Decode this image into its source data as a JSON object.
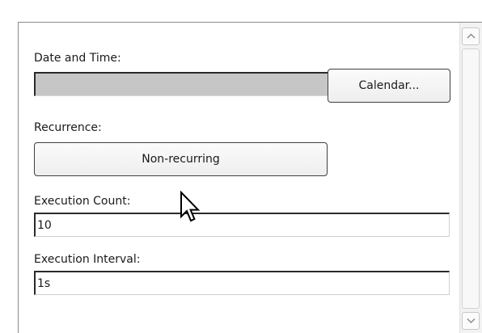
{
  "form": {
    "datetime_label": "Date and Time:",
    "datetime_value": "",
    "calendar_button": "Calendar...",
    "recurrence_label": "Recurrence:",
    "recurrence_button": "Non-recurring",
    "execution_count_label": "Execution Count:",
    "execution_count_value": "10",
    "execution_interval_label": "Execution Interval:",
    "execution_interval_value": "1s"
  },
  "icons": {
    "scroll_up": "chevron-up-icon",
    "scroll_down": "chevron-down-icon",
    "cursor": "mouse-pointer-icon"
  },
  "colors": {
    "disabled_field": "#c6c6c6",
    "border_dark": "#2a2a2a",
    "frame_border": "#8a8a8a"
  }
}
